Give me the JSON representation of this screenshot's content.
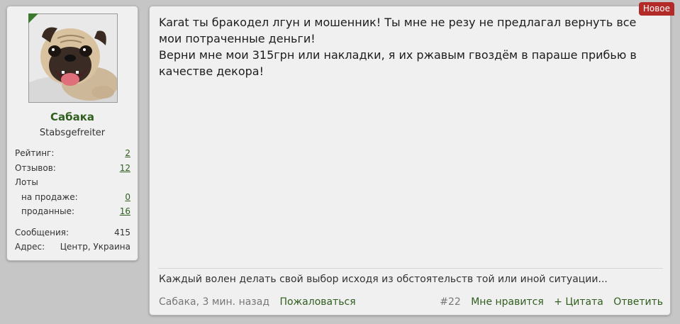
{
  "user": {
    "name": "Сабака",
    "title": "Stabsgefreiter",
    "online_color": "#3b7a2e",
    "stats": {
      "rating_label": "Рейтинг:",
      "rating_value": "2",
      "reviews_label": "Отзывов:",
      "reviews_value": "12",
      "lots_label": "Лоты",
      "on_sale_label": "на продаже:",
      "on_sale_value": "0",
      "sold_label": "проданные:",
      "sold_value": "16",
      "messages_label": "Сообщения:",
      "messages_value": "415",
      "address_label": "Адрес:",
      "address_value": "Центр, Украина"
    }
  },
  "post": {
    "badge": "Новое",
    "lines": [
      "Karat ты бракодел лгун и мошенник! Ты мне не резу не предлагал вернуть все мои потраченные деньги!",
      "Верни мне мои 315грн или накладки, я их ржавым гвоздём в параше прибью в качестве декора!"
    ],
    "signature": "Каждый волен делать свой выбор исходя из обстоятельств той или иной ситуации...",
    "author_date": "Сабака, 3 мин. назад",
    "report": "Пожаловаться",
    "number": "#22",
    "like": "Мне нравится",
    "quote": "+ Цитата",
    "reply": "Ответить"
  },
  "colors": {
    "link": "#2f5e1e",
    "badge": "#b22b28",
    "background": "#c6c6c6",
    "panel": "#f0f0f0"
  }
}
